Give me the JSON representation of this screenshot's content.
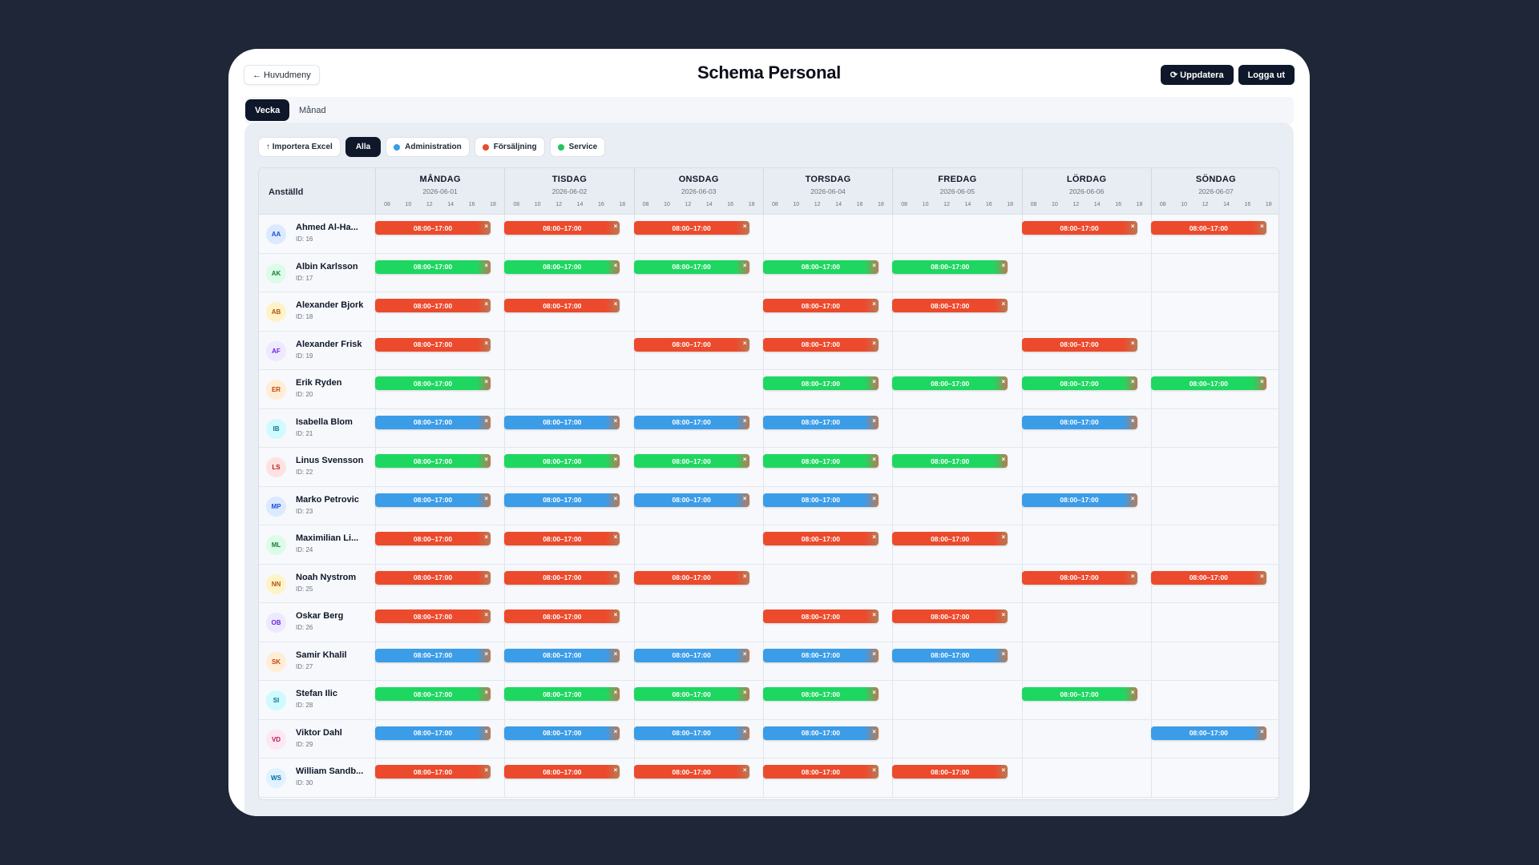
{
  "header": {
    "back_label": "← Huvudmeny",
    "title": "Schema Personal",
    "refresh_label": "⟳ Uppdatera",
    "logout_label": "Logga ut"
  },
  "view_tabs": [
    {
      "label": "Vecka",
      "active": true
    },
    {
      "label": "Månad",
      "active": false
    }
  ],
  "filters": {
    "import_label": "↑ Importera Excel",
    "all_label": "Alla",
    "departments": [
      {
        "label": "Administration",
        "color": "#3b9ce8"
      },
      {
        "label": "Försäljning",
        "color": "#e84a2e"
      },
      {
        "label": "Service",
        "color": "#22c55e"
      }
    ]
  },
  "grid": {
    "employee_header": "Anställd",
    "hour_labels": [
      "08",
      "10",
      "12",
      "14",
      "16",
      "18"
    ],
    "days": [
      {
        "name": "MÅNDAG",
        "date": "2026-06-01"
      },
      {
        "name": "TISDAG",
        "date": "2026-06-02"
      },
      {
        "name": "ONSDAG",
        "date": "2026-06-03"
      },
      {
        "name": "TORSDAG",
        "date": "2026-06-04"
      },
      {
        "name": "FREDAG",
        "date": "2026-06-05"
      },
      {
        "name": "LÖRDAG",
        "date": "2026-06-06"
      },
      {
        "name": "SÖNDAG",
        "date": "2026-06-07"
      }
    ],
    "shift_label": "08:00–17:00",
    "remove_icon": "×",
    "employees": [
      {
        "initials": "AA",
        "name": "Ahmed Al-Ha...",
        "id": "ID: 16",
        "dept": "sales",
        "days": [
          1,
          1,
          1,
          0,
          0,
          1,
          1
        ]
      },
      {
        "initials": "AK",
        "name": "Albin Karlsson",
        "id": "ID: 17",
        "dept": "service",
        "days": [
          1,
          1,
          1,
          1,
          1,
          0,
          0
        ]
      },
      {
        "initials": "AB",
        "name": "Alexander Bjork",
        "id": "ID: 18",
        "dept": "sales",
        "days": [
          1,
          1,
          0,
          1,
          1,
          0,
          0
        ]
      },
      {
        "initials": "AF",
        "name": "Alexander Frisk",
        "id": "ID: 19",
        "dept": "sales",
        "days": [
          1,
          0,
          1,
          1,
          0,
          1,
          0
        ]
      },
      {
        "initials": "ER",
        "name": "Erik Ryden",
        "id": "ID: 20",
        "dept": "service",
        "days": [
          1,
          0,
          0,
          1,
          1,
          1,
          1
        ]
      },
      {
        "initials": "IB",
        "name": "Isabella Blom",
        "id": "ID: 21",
        "dept": "admin",
        "days": [
          1,
          1,
          1,
          1,
          0,
          1,
          0
        ]
      },
      {
        "initials": "LS",
        "name": "Linus Svensson",
        "id": "ID: 22",
        "dept": "service",
        "days": [
          1,
          1,
          1,
          1,
          1,
          0,
          0
        ]
      },
      {
        "initials": "MP",
        "name": "Marko Petrovic",
        "id": "ID: 23",
        "dept": "admin",
        "days": [
          1,
          1,
          1,
          1,
          0,
          1,
          0
        ]
      },
      {
        "initials": "ML",
        "name": "Maximilian Li...",
        "id": "ID: 24",
        "dept": "sales",
        "days": [
          1,
          1,
          0,
          1,
          1,
          0,
          0
        ]
      },
      {
        "initials": "NN",
        "name": "Noah Nystrom",
        "id": "ID: 25",
        "dept": "sales",
        "days": [
          1,
          1,
          1,
          0,
          0,
          1,
          1
        ]
      },
      {
        "initials": "OB",
        "name": "Oskar Berg",
        "id": "ID: 26",
        "dept": "sales",
        "days": [
          1,
          1,
          0,
          1,
          1,
          0,
          0
        ]
      },
      {
        "initials": "SK",
        "name": "Samir Khalil",
        "id": "ID: 27",
        "dept": "admin",
        "days": [
          1,
          1,
          1,
          1,
          1,
          0,
          0
        ]
      },
      {
        "initials": "SI",
        "name": "Stefan Ilic",
        "id": "ID: 28",
        "dept": "service",
        "days": [
          1,
          1,
          1,
          1,
          0,
          1,
          0
        ]
      },
      {
        "initials": "VD",
        "name": "Viktor Dahl",
        "id": "ID: 29",
        "dept": "admin",
        "days": [
          1,
          1,
          1,
          1,
          0,
          0,
          1
        ]
      },
      {
        "initials": "WS",
        "name": "William Sandb...",
        "id": "ID: 30",
        "dept": "sales",
        "days": [
          1,
          1,
          1,
          1,
          1,
          0,
          0
        ]
      }
    ]
  },
  "colors": {
    "sales": "#ec4a2c",
    "service": "#1ed760",
    "admin": "#3b9ce8"
  }
}
